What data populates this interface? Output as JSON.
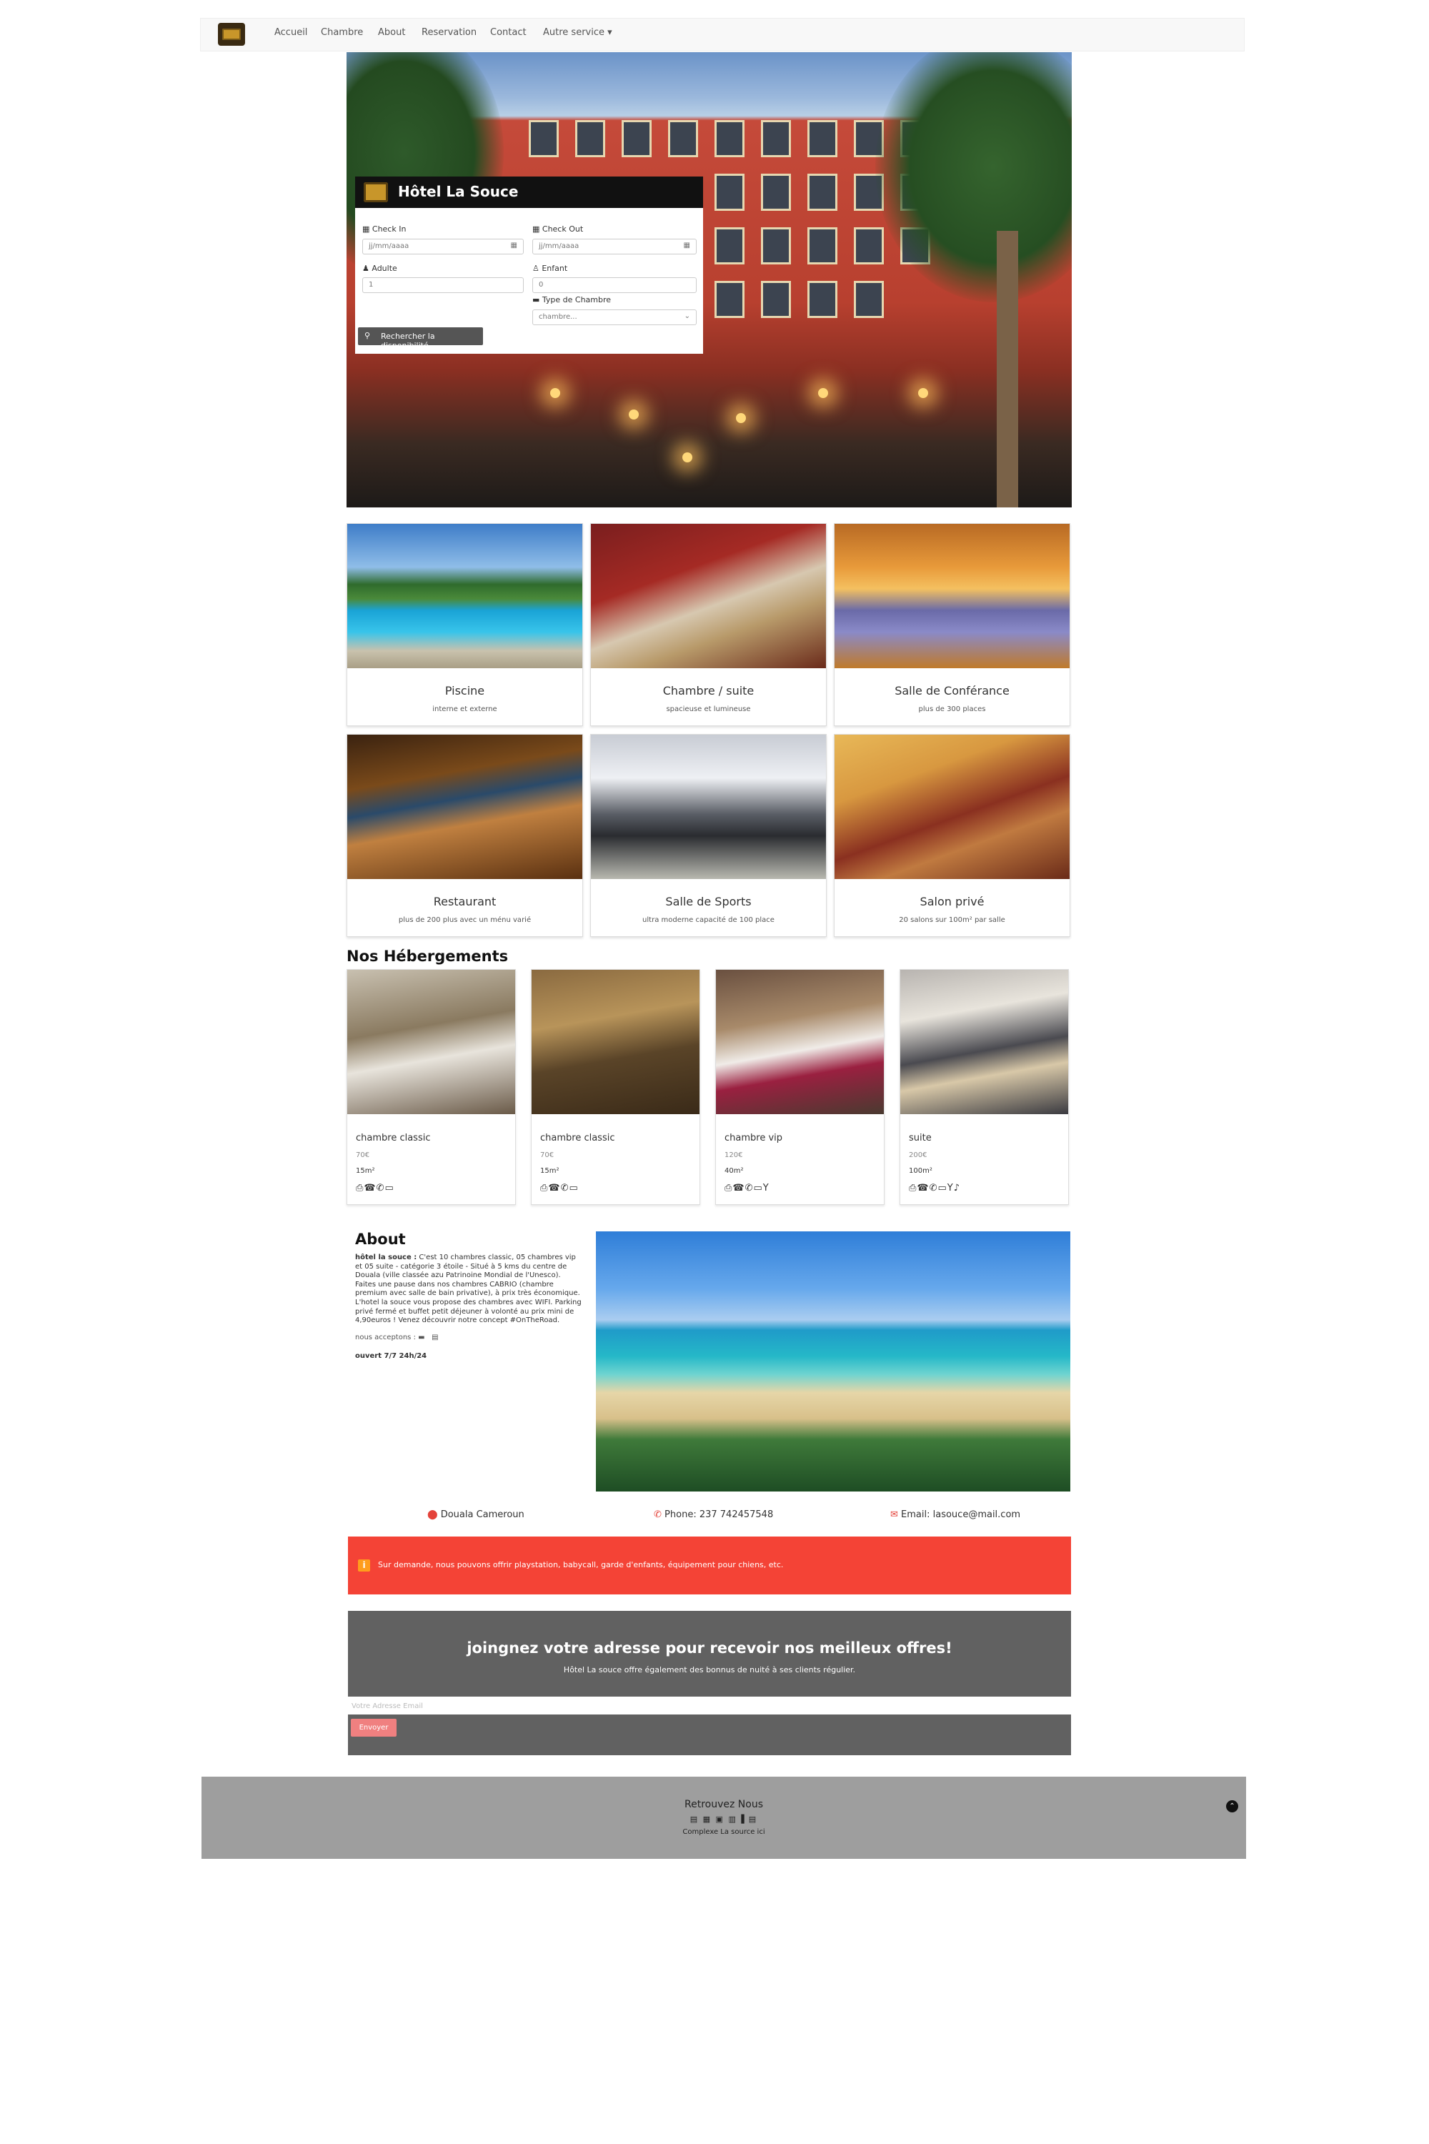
{
  "navbar": {
    "brand": "logo",
    "items": [
      "Accueil",
      "Chambre",
      "About",
      "Reservation",
      "Contact",
      "Autre service ▾"
    ]
  },
  "booking": {
    "title": "Hôtel La Souce",
    "check_in_label": "Check In",
    "check_out_label": "Check Out",
    "date_placeholder": "jj/mm/aaaa",
    "adult_label": "Adulte",
    "adult_value": "1",
    "child_label": "Enfant",
    "child_value": "0",
    "room_type_label": "Type de Chambre",
    "room_type_value": "chambre...",
    "search_button": "Rechercher la disponibilité"
  },
  "features": [
    {
      "title": "Piscine",
      "subtitle": "interne et externe"
    },
    {
      "title": "Chambre / suite",
      "subtitle": "spacieuse et lumineuse"
    },
    {
      "title": "Salle de Conférance",
      "subtitle": "plus de 300 places"
    },
    {
      "title": "Restaurant",
      "subtitle": "plus de 200 plus avec un ménu varié"
    },
    {
      "title": "Salle de Sports",
      "subtitle": "ultra moderne capacité de 100 place"
    },
    {
      "title": "Salon privé",
      "subtitle": "20 salons sur 100m² par salle"
    }
  ],
  "accommodations": {
    "heading": "Nos Hébergements",
    "rooms": [
      {
        "name": "chambre classic",
        "price": "70€",
        "area": "15m²",
        "amenities": "⎙☎✆▭"
      },
      {
        "name": "chambre classic",
        "price": "70€",
        "area": "15m²",
        "amenities": "⎙☎✆▭"
      },
      {
        "name": "chambre vip",
        "price": "120€",
        "area": "40m²",
        "amenities": "⎙☎✆▭Y"
      },
      {
        "name": "suite",
        "price": "200€",
        "area": "100m²",
        "amenities": "⎙☎✆▭Y♪"
      }
    ]
  },
  "about": {
    "heading": "About",
    "hotel_name": "hôtel la souce :",
    "text": " C'est 10 chambres classic, 05 chambres vip et 05 suite - catégorie 3 étoile - Situé à 5 kms du centre de Douala (ville classée azu Patrinoine Mondial de l'Unesco). Faites une pause dans nos chambres CABRIO (chambre premium avec salle de bain privative), à prix très économique. L'hotel la souce vous propose des chambres avec WIFI. Parking privé fermé et buffet petit déjeuner à volonté au prix mini de 4,90euros ! Venez découvrir notre concept #OnTheRoad.",
    "accept_label": "nous acceptons :",
    "hours": "ouvert 7/7 24h/24"
  },
  "contact": {
    "location": "Douala Cameroun",
    "phone": "Phone: 237 742457548",
    "email": "Email: lasouce@mail.com"
  },
  "alert": {
    "icon": "i",
    "text": "Sur demande, nous pouvons offrir playstation, babycall, garde d'enfants, équipement pour chiens, etc."
  },
  "newsletter": {
    "heading": "joingnez votre adresse pour recevoir nos meilleux offres!",
    "subheading": "Hôtel La souce offre également des bonnus de nuité à ses clients régulier.",
    "email_placeholder": "Votre Adresse Email",
    "send_button": "Envoyer"
  },
  "footer": {
    "heading": "Retrouvez Nous",
    "social_icons": "▤ ▦ ▣ ▥ ▌▤",
    "copyright": "Complexe La source ici",
    "up_icon": "⌃"
  },
  "colors": {
    "accent_red": "#f44336",
    "newsletter_bg": "#616161",
    "footer_bg": "#9e9e9e",
    "send_button": "#f08080"
  }
}
